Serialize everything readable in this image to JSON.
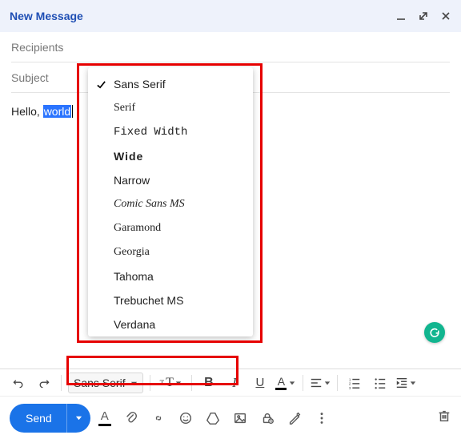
{
  "header": {
    "title": "New Message"
  },
  "fields": {
    "recipients_label": "Recipients",
    "subject_label": "Subject"
  },
  "body": {
    "prefix": "Hello, ",
    "selected": "world"
  },
  "font_menu": {
    "items": [
      {
        "label": "Sans Serif",
        "selected": true,
        "css": ""
      },
      {
        "label": "Serif",
        "selected": false,
        "css": "font-serif"
      },
      {
        "label": "Fixed Width",
        "selected": false,
        "css": "font-fixed"
      },
      {
        "label": "Wide",
        "selected": false,
        "css": "font-wide"
      },
      {
        "label": "Narrow",
        "selected": false,
        "css": "font-narrow"
      },
      {
        "label": "Comic Sans MS",
        "selected": false,
        "css": "font-comic"
      },
      {
        "label": "Garamond",
        "selected": false,
        "css": "font-garamond"
      },
      {
        "label": "Georgia",
        "selected": false,
        "css": "font-georgia"
      },
      {
        "label": "Tahoma",
        "selected": false,
        "css": "font-tahoma"
      },
      {
        "label": "Trebuchet MS",
        "selected": false,
        "css": "font-trebuchet"
      },
      {
        "label": "Verdana",
        "selected": false,
        "css": "font-verdana"
      }
    ]
  },
  "toolbar": {
    "font_selector_value": "Sans Serif",
    "bold_label": "B",
    "italic_label": "I",
    "underline_label": "U",
    "text_color_label": "A"
  },
  "bottom": {
    "send_label": "Send",
    "format_button_label": "A"
  }
}
